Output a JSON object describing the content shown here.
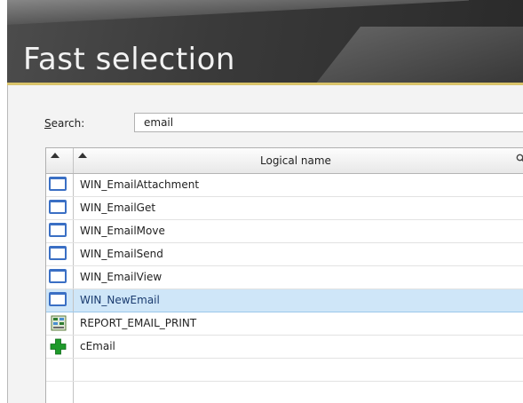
{
  "window": {
    "title": "Fast selection",
    "accent_color": "#d9c36a",
    "header_color": "#3a3a3a"
  },
  "search": {
    "label_underlined": "S",
    "label_rest": "earch:",
    "value": "email"
  },
  "grid": {
    "column_header": "Logical name",
    "sort_icon": "triangle-up-icon",
    "column_search_icon": "magnifier-icon",
    "selection_color": "#cfe6f8",
    "rows": [
      {
        "name": "WIN_EmailAttachment",
        "icon": "window-icon"
      },
      {
        "name": "WIN_EmailGet",
        "icon": "window-icon"
      },
      {
        "name": "WIN_EmailMove",
        "icon": "window-icon"
      },
      {
        "name": "WIN_EmailSend",
        "icon": "window-icon"
      },
      {
        "name": "WIN_EmailView",
        "icon": "window-icon"
      },
      {
        "name": "WIN_NewEmail",
        "icon": "window-icon",
        "selected": true
      },
      {
        "name": "REPORT_EMAIL_PRINT",
        "icon": "report-icon"
      },
      {
        "name": "cEmail",
        "icon": "class-icon"
      }
    ]
  }
}
